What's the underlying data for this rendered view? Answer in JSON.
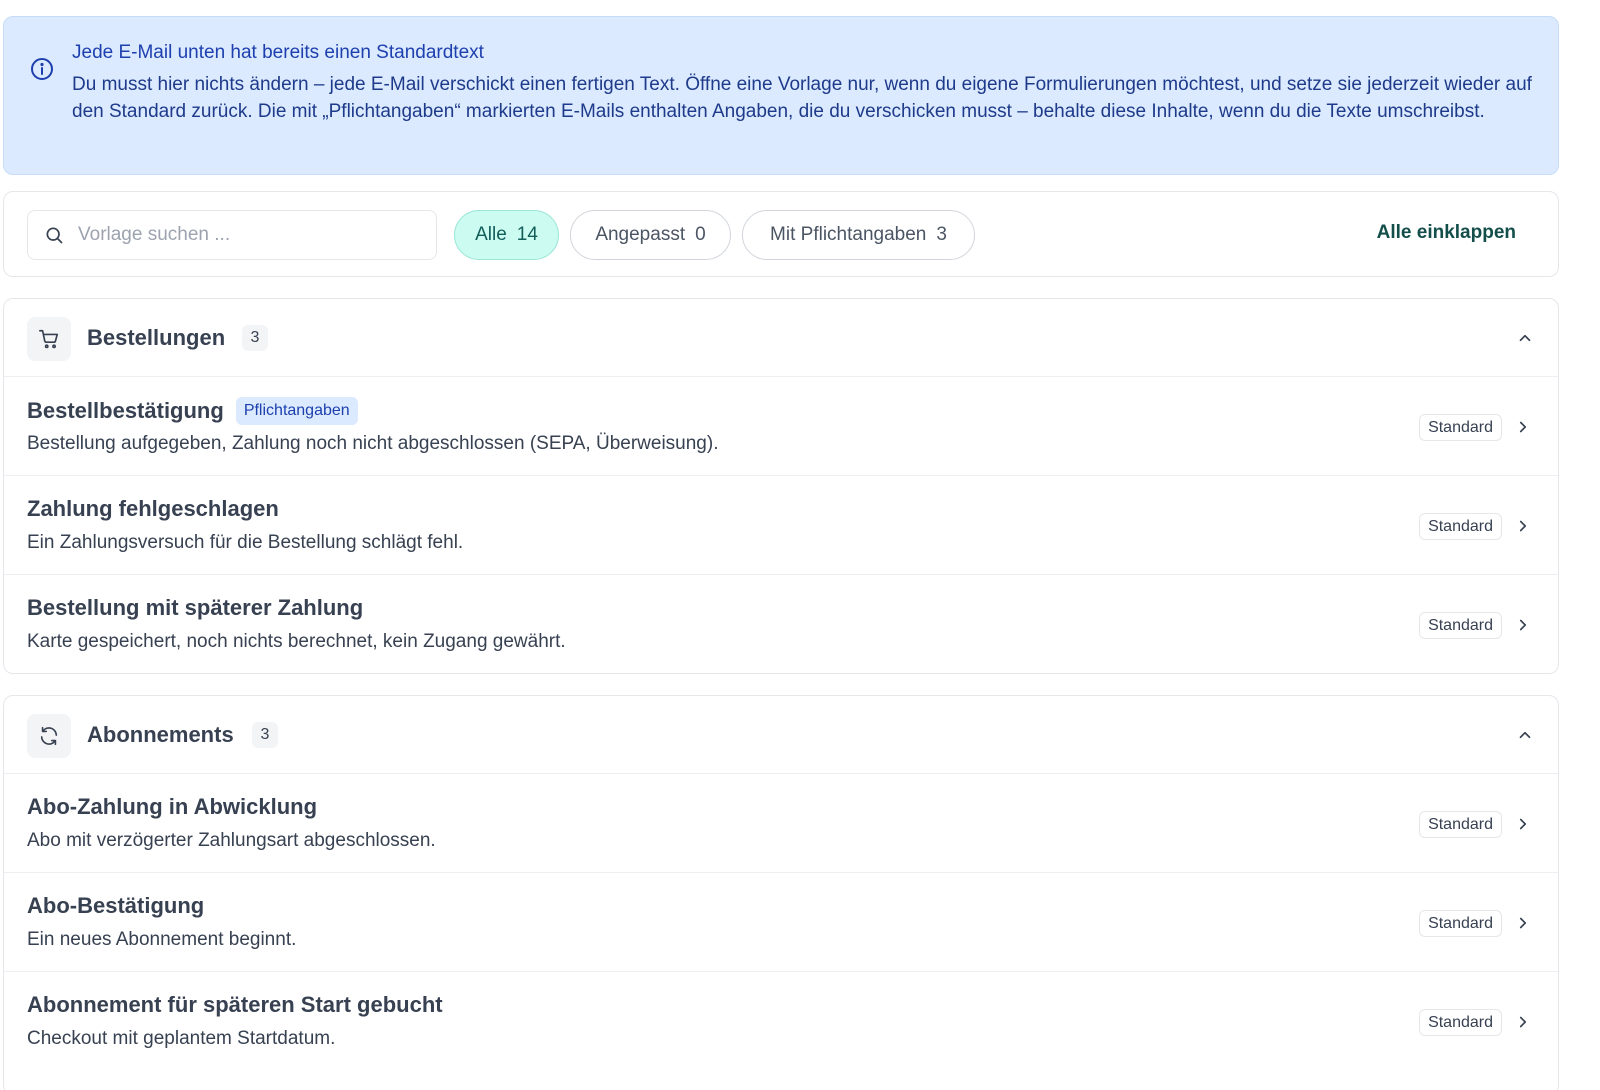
{
  "info": {
    "title": "Jede E-Mail unten hat bereits einen Standardtext",
    "body": "Du musst hier nichts ändern – jede E-Mail verschickt einen fertigen Text. Öffne eine Vorlage nur, wenn du eigene Formulierungen möchtest, und setze sie jederzeit wieder auf den Standard zurück. Die mit „Pflichtangaben“ markierten E-Mails enthalten Angaben, die du verschicken musst – behalte diese Inhalte, wenn du die Texte umschreibst.",
    "icon": "info-icon"
  },
  "toolbar": {
    "search_placeholder": "Vorlage suchen ...",
    "filters": [
      {
        "label": "Alle",
        "count": "14",
        "active": true
      },
      {
        "label": "Angepasst",
        "count": "0",
        "active": false
      },
      {
        "label": "Mit Pflichtangaben",
        "count": "3",
        "active": false
      }
    ],
    "collapse_all_label": "Alle einklappen"
  },
  "sections": [
    {
      "title": "Bestellungen",
      "count": "3",
      "icon": "cart-icon",
      "items": [
        {
          "title": "Bestellbestätigung",
          "badge": "Pflichtangaben",
          "description": "Bestellung aufgegeben, Zahlung noch nicht abgeschlossen (SEPA, Überweisung).",
          "status": "Standard"
        },
        {
          "title": "Zahlung fehlgeschlagen",
          "badge": "",
          "description": "Ein Zahlungsversuch für die Bestellung schlägt fehl.",
          "status": "Standard"
        },
        {
          "title": "Bestellung mit späterer Zahlung",
          "badge": "",
          "description": "Karte gespeichert, noch nichts berechnet, kein Zugang gewährt.",
          "status": "Standard"
        }
      ]
    },
    {
      "title": "Abonnements",
      "count": "3",
      "icon": "refresh-icon",
      "items": [
        {
          "title": "Abo-Zahlung in Abwicklung",
          "badge": "",
          "description": "Abo mit verzögerter Zahlungsart abgeschlossen.",
          "status": "Standard"
        },
        {
          "title": "Abo-Bestätigung",
          "badge": "",
          "description": "Ein neues Abonnement beginnt.",
          "status": "Standard"
        },
        {
          "title": "Abonnement für späteren Start gebucht",
          "badge": "",
          "description": "Checkout mit geplantem Startdatum.",
          "status": "Standard"
        }
      ]
    }
  ],
  "colors": {
    "info_bg": "#dbeafe",
    "info_text": "#1e40af",
    "active_chip_bg": "#ccfbf1",
    "link": "#134e4a"
  }
}
